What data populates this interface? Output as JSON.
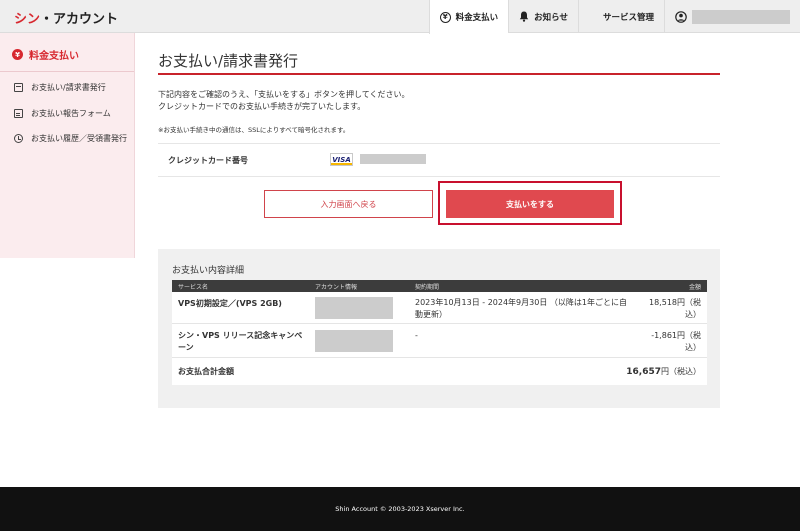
{
  "header": {
    "logo_red": "シン",
    "logo_rest": "・アカウント",
    "nav": {
      "billing": "料金支払い",
      "news": "お知らせ",
      "services": "サービス管理"
    }
  },
  "sidebar": {
    "title": "料金支払い",
    "items": [
      {
        "label": "お支払い/請求書発行"
      },
      {
        "label": "お支払い報告フォーム"
      },
      {
        "label": "お支払い履歴／受領書発行"
      }
    ]
  },
  "main": {
    "title": "お支払い/請求書発行",
    "desc_line1": "下記内容をご確認のうえ、「支払いをする」ボタンを押してください。",
    "desc_line2": "クレジットカードでのお支払い手続きが完了いたします。",
    "note": "※お支払い手続き中の通信は、SSLによりすべて暗号化されます。",
    "card_label": "クレジットカード番号",
    "card_brand": "VISA",
    "back_button": "入力画面へ戻る",
    "pay_button": "支払いをする"
  },
  "details": {
    "title": "お支払い内容詳細",
    "columns": [
      "サービス名",
      "アカウント情報",
      "契約期間",
      "金額"
    ],
    "rows": [
      {
        "service": "VPS初期設定／(VPS 2GB)",
        "period_l1": "2023年10月13日 - 2024年9月30日 （以降は1年ごとに自",
        "period_l2": "動更新）",
        "amount_l1": "18,518円（税",
        "amount_l2": "込）"
      },
      {
        "service_l1": "シン・VPS リリース記念キャンペ",
        "service_l2": "ーン",
        "period": "-",
        "amount_l1": "-1,861円（税",
        "amount_l2": "込）"
      }
    ],
    "total_label": "お支払合計金額",
    "total_amount": "16,657",
    "total_suffix": "円（税込）"
  },
  "footer": {
    "copyright": "Shin Account © 2003-2023 Xserver Inc."
  }
}
